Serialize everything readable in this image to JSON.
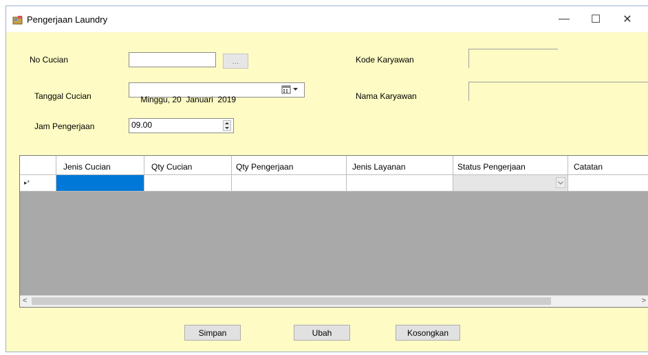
{
  "window": {
    "title": "Pengerjaan Laundry",
    "controls": {
      "minimize": "—",
      "maximize": "☐",
      "close": "✕"
    }
  },
  "form": {
    "no_cucian_label": "No Cucian",
    "no_cucian_value": "",
    "browse_label": "...",
    "tanggal_label": "Tanggal Cucian",
    "tanggal_value": "Minggu, 20  Januari  2019",
    "jam_label": "Jam Pengerjaan",
    "jam_value": "09.00",
    "kode_label": "Kode Karyawan",
    "kode_value": "",
    "nama_label": "Nama Karyawan",
    "nama_value": ""
  },
  "grid": {
    "columns": [
      "Jenis Cucian",
      "Qty Cucian",
      "Qty Pengerjaan",
      "Jenis Layanan",
      "Status Pengerjaan",
      "Catatan"
    ],
    "row_marker": "▸*",
    "scroll_left": "<",
    "scroll_right": ">"
  },
  "buttons": {
    "simpan": "Simpan",
    "ubah": "Ubah",
    "kosongkan": "Kosongkan"
  },
  "colors": {
    "form_bg": "#fefbc4",
    "grid_bg": "#a9a9a9",
    "selected_cell": "#0078d7"
  },
  "icons": {
    "app": "laundry-app-icon",
    "calendar": "calendar-icon",
    "spin": "spin-updown-icon",
    "dropdown": "chevron-down-icon"
  }
}
